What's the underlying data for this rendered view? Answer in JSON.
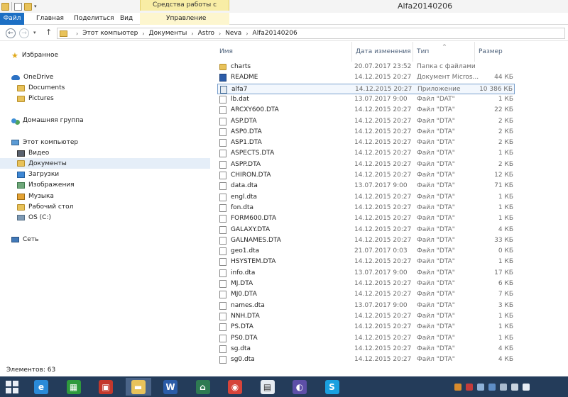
{
  "window": {
    "title": "Alfa20140206",
    "context_tab_group": "Средства работы с рисунками"
  },
  "ribbon": {
    "tabs": [
      {
        "label": "Файл"
      },
      {
        "label": "Главная"
      },
      {
        "label": "Поделиться"
      },
      {
        "label": "Вид"
      },
      {
        "label": "Управление"
      }
    ]
  },
  "address": {
    "crumbs": [
      "Этот компьютер",
      "Документы",
      "Astro",
      "Neva",
      "Alfa20140206"
    ]
  },
  "nav": {
    "items": [
      {
        "label": "Избранное",
        "icon": "star-icon"
      },
      {
        "label": "OneDrive",
        "icon": "cloud-icon"
      },
      {
        "label": "Documents",
        "icon": "folder-icon"
      },
      {
        "label": "Pictures",
        "icon": "folder-icon"
      },
      {
        "label": "Домашняя группа",
        "icon": "homegroup-icon"
      },
      {
        "label": "Этот компьютер",
        "icon": "computer-icon"
      },
      {
        "label": "Видео",
        "icon": "video-folder-icon"
      },
      {
        "label": "Документы",
        "icon": "documents-folder-icon"
      },
      {
        "label": "Загрузки",
        "icon": "downloads-folder-icon"
      },
      {
        "label": "Изображения",
        "icon": "pictures-folder-icon"
      },
      {
        "label": "Музыка",
        "icon": "music-folder-icon"
      },
      {
        "label": "Рабочий стол",
        "icon": "desktop-folder-icon"
      },
      {
        "label": "OS (C:)",
        "icon": "drive-icon"
      },
      {
        "label": "Сеть",
        "icon": "network-icon"
      }
    ],
    "selected": "Документы"
  },
  "columns": {
    "name": "Имя",
    "date": "Дата изменения",
    "type": "Тип",
    "size": "Размер"
  },
  "files": [
    {
      "name": "charts",
      "date": "20.07.2017 23:52",
      "type": "Папка с файлами",
      "size": "",
      "icon": "folder-icon"
    },
    {
      "name": "README",
      "date": "14.12.2015 20:27",
      "type": "Документ Micros...",
      "size": "44 КБ",
      "icon": "word-document-icon"
    },
    {
      "name": "alfa7",
      "date": "14.12.2015 20:27",
      "type": "Приложение",
      "size": "10 386 КБ",
      "icon": "application-icon"
    },
    {
      "name": "lb.dat",
      "date": "13.07.2017 9:00",
      "type": "Файл \"DAT\"",
      "size": "1 КБ",
      "icon": "file-icon"
    },
    {
      "name": "ARCXY600.DTA",
      "date": "14.12.2015 20:27",
      "type": "Файл \"DTA\"",
      "size": "22 КБ",
      "icon": "file-icon"
    },
    {
      "name": "ASP.DTA",
      "date": "14.12.2015 20:27",
      "type": "Файл \"DTA\"",
      "size": "2 КБ",
      "icon": "file-icon"
    },
    {
      "name": "ASP0.DTA",
      "date": "14.12.2015 20:27",
      "type": "Файл \"DTA\"",
      "size": "2 КБ",
      "icon": "file-icon"
    },
    {
      "name": "ASP1.DTA",
      "date": "14.12.2015 20:27",
      "type": "Файл \"DTA\"",
      "size": "2 КБ",
      "icon": "file-icon"
    },
    {
      "name": "ASPECTS.DTA",
      "date": "14.12.2015 20:27",
      "type": "Файл \"DTA\"",
      "size": "1 КБ",
      "icon": "file-icon"
    },
    {
      "name": "ASPP.DTA",
      "date": "14.12.2015 20:27",
      "type": "Файл \"DTA\"",
      "size": "2 КБ",
      "icon": "file-icon"
    },
    {
      "name": "CHIRON.DTA",
      "date": "14.12.2015 20:27",
      "type": "Файл \"DTA\"",
      "size": "12 КБ",
      "icon": "file-icon"
    },
    {
      "name": "data.dta",
      "date": "13.07.2017 9:00",
      "type": "Файл \"DTA\"",
      "size": "71 КБ",
      "icon": "file-icon"
    },
    {
      "name": "engl.dta",
      "date": "14.12.2015 20:27",
      "type": "Файл \"DTA\"",
      "size": "1 КБ",
      "icon": "file-icon"
    },
    {
      "name": "fon.dta",
      "date": "14.12.2015 20:27",
      "type": "Файл \"DTA\"",
      "size": "1 КБ",
      "icon": "file-icon"
    },
    {
      "name": "FORM600.DTA",
      "date": "14.12.2015 20:27",
      "type": "Файл \"DTA\"",
      "size": "1 КБ",
      "icon": "file-icon"
    },
    {
      "name": "GALAXY.DTA",
      "date": "14.12.2015 20:27",
      "type": "Файл \"DTA\"",
      "size": "4 КБ",
      "icon": "file-icon"
    },
    {
      "name": "GALNAMES.DTA",
      "date": "14.12.2015 20:27",
      "type": "Файл \"DTA\"",
      "size": "33 КБ",
      "icon": "file-icon"
    },
    {
      "name": "geo1.dta",
      "date": "21.07.2017 0:03",
      "type": "Файл \"DTA\"",
      "size": "0 КБ",
      "icon": "file-icon"
    },
    {
      "name": "HSYSTEM.DTA",
      "date": "14.12.2015 20:27",
      "type": "Файл \"DTA\"",
      "size": "1 КБ",
      "icon": "file-icon"
    },
    {
      "name": "info.dta",
      "date": "13.07.2017 9:00",
      "type": "Файл \"DTA\"",
      "size": "17 КБ",
      "icon": "file-icon"
    },
    {
      "name": "MJ.DTA",
      "date": "14.12.2015 20:27",
      "type": "Файл \"DTA\"",
      "size": "6 КБ",
      "icon": "file-icon"
    },
    {
      "name": "MJ0.DTA",
      "date": "14.12.2015 20:27",
      "type": "Файл \"DTA\"",
      "size": "7 КБ",
      "icon": "file-icon"
    },
    {
      "name": "names.dta",
      "date": "13.07.2017 9:00",
      "type": "Файл \"DTA\"",
      "size": "3 КБ",
      "icon": "file-icon"
    },
    {
      "name": "NNH.DTA",
      "date": "14.12.2015 20:27",
      "type": "Файл \"DTA\"",
      "size": "1 КБ",
      "icon": "file-icon"
    },
    {
      "name": "PS.DTA",
      "date": "14.12.2015 20:27",
      "type": "Файл \"DTA\"",
      "size": "1 КБ",
      "icon": "file-icon"
    },
    {
      "name": "PS0.DTA",
      "date": "14.12.2015 20:27",
      "type": "Файл \"DTA\"",
      "size": "1 КБ",
      "icon": "file-icon"
    },
    {
      "name": "sg.dta",
      "date": "14.12.2015 20:27",
      "type": "Файл \"DTA\"",
      "size": "4 КБ",
      "icon": "file-icon"
    },
    {
      "name": "sg0.dta",
      "date": "14.12.2015 20:27",
      "type": "Файл \"DTA\"",
      "size": "4 КБ",
      "icon": "file-icon"
    }
  ],
  "selected_file": "alfa7",
  "status": {
    "items_count": "Элементов: 63"
  },
  "taskbar": {
    "apps": [
      {
        "icon": "internet-explorer-icon"
      },
      {
        "icon": "store-icon"
      },
      {
        "icon": "media-app-icon"
      },
      {
        "icon": "file-explorer-icon"
      },
      {
        "icon": "word-icon"
      },
      {
        "icon": "astro-app-icon"
      },
      {
        "icon": "chrome-icon"
      },
      {
        "icon": "image-viewer-icon"
      },
      {
        "icon": "sound-app-icon"
      },
      {
        "icon": "skype-icon"
      }
    ],
    "active_app": "file-explorer-icon"
  },
  "colors": {
    "accent": "#1c6fc4",
    "context_tab": "#f8eda5",
    "taskbar": "#243c5a",
    "selection_border": "#7da2ce"
  }
}
